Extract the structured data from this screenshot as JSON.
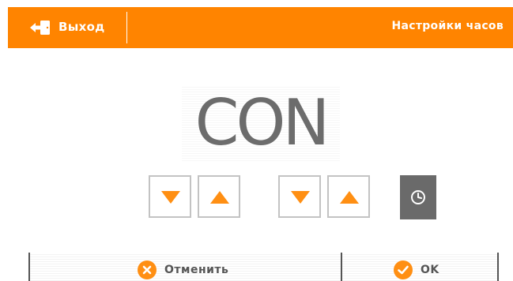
{
  "header": {
    "exit_label": "Выход",
    "exit_icon": "exit-door-icon",
    "title": "Настройки часов"
  },
  "display": {
    "value": "CON"
  },
  "controls": {
    "left_pair": [
      "arrow-down-icon",
      "arrow-up-icon"
    ],
    "right_pair": [
      "arrow-down-icon",
      "arrow-up-icon"
    ],
    "clock_icon": "clock-icon"
  },
  "footer": {
    "cancel_label": "Отменить",
    "cancel_icon": "x-circle-icon",
    "ok_label": "OK",
    "ok_icon": "check-circle-icon"
  },
  "colors": {
    "accent": "#ff8400",
    "icon_orange": "#ff8f13",
    "display_text": "#6c6c6c",
    "clock_button": "#6a6a6a",
    "button_border": "#c3c3c3"
  }
}
